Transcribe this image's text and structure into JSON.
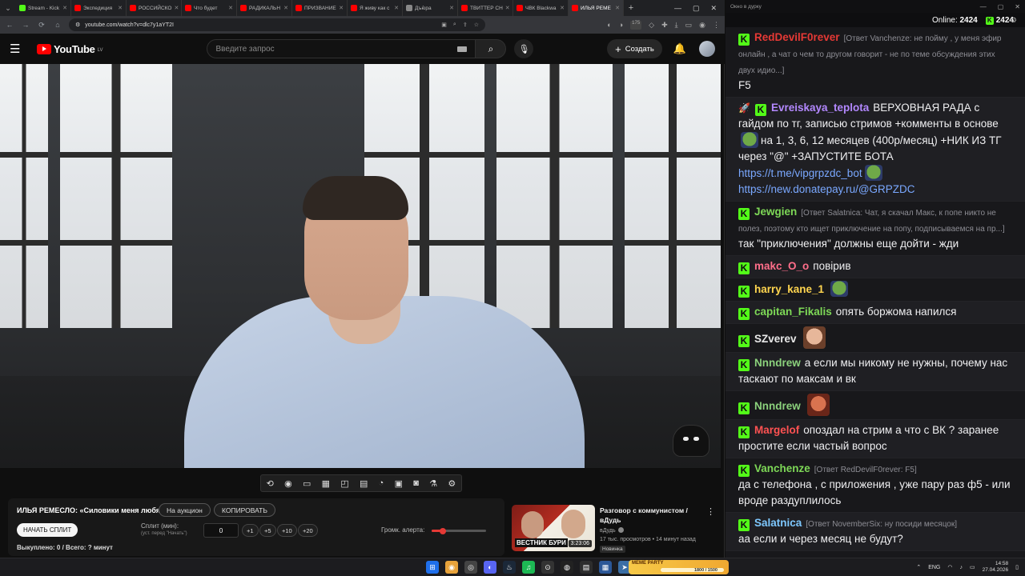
{
  "browser": {
    "tabs": [
      {
        "title": "Stream - Kick",
        "color": "#53fc18",
        "active": false
      },
      {
        "title": "Экспедиция",
        "color": "#ff0000",
        "active": false
      },
      {
        "title": "РОССИЙСКО",
        "color": "#ff0000",
        "active": false
      },
      {
        "title": "Что будет",
        "color": "#ff0000",
        "active": false
      },
      {
        "title": "РАДИКАЛЬН",
        "color": "#ff0000",
        "active": false
      },
      {
        "title": "ПРИЗВАНИЕ",
        "color": "#ff0000",
        "active": false
      },
      {
        "title": "Я живу как с",
        "color": "#ff0000",
        "active": false
      },
      {
        "title": "Дъю̀ра",
        "color": "#888888",
        "active": false
      },
      {
        "title": "ТВИТТЕР СН",
        "color": "#ff0000",
        "active": false
      },
      {
        "title": "ЧВК Blackwa",
        "color": "#ff0000",
        "active": false
      },
      {
        "title": "ИЛЬЯ РЕМЕ",
        "color": "#ff0000",
        "active": true
      }
    ],
    "url": "youtube.com/watch?v=dlc7y1aYT2I",
    "extension_badge": "175"
  },
  "youtube": {
    "logo_text": "YouTube",
    "region": "LV",
    "search_placeholder": "Введите запрос",
    "create_label": "Создать"
  },
  "auction": {
    "title": "ИЛЬЯ РЕМЕСЛО: «Силовики меня любят»",
    "to_auction_label": "На аукцион",
    "copy_label": "КОПИРОВАТЬ",
    "start_split_label": "НАЧАТЬ СПЛИТ",
    "split_label": "Сплит (мин):",
    "split_hint": "(уст. перед \"Начать\")",
    "split_value": "0",
    "increments": [
      "+1",
      "+5",
      "+10",
      "+20"
    ],
    "volume_label": "Громк. алерта:",
    "volume_level": 0.2,
    "stats": "Выкуплено: 0 / Всего: ? минут"
  },
  "recommendation": {
    "title": "Разговор с коммунистом / вДудь",
    "channel": "вДудь",
    "meta": "17 тыс. просмотров • 14 минут назад",
    "badge": "Новинка",
    "duration": "3:23:06",
    "thumb_caption": "ВЕСТНИК БУРИ"
  },
  "chat": {
    "window_title": "Окно в дурку",
    "online_label": "Online:",
    "online_count": "2424",
    "viewers": "2424",
    "messages": [
      {
        "user": "RedDevilF0rever",
        "color": "#e53935",
        "reply": "[Ответ Vanchenze: не пойму , у меня эфир онлайн , а чат о чем то другом говорит - не по теме обсуждения этих двух идио...]",
        "text": "F5"
      },
      {
        "user": "Evreiskaya_teplota",
        "color": "#b388ff",
        "text_parts": [
          "ВЕРХОВНАЯ РАДА с гайдом по тг, записью стримов +комменты в основе",
          "на 1, 3, 6, 12 месяцев (400р/месяц) +НИК ИЗ ТГ через \"@\" +ЗАПУСТИТЕ БОТА"
        ],
        "link1": "https://t.me/vipgrpzdc_bot",
        "link2": "https://new.donatepay.ru/@GRPZDC"
      },
      {
        "user": "Jewgien",
        "color": "#7ed957",
        "reply": "[Ответ Salatnica: Чат, я скачал Макс, к попе никто не полез, поэтому кто ищет приключение на попу, подписываемся на пр...]",
        "text": "так \"приключения\" должны еще дойти - жди"
      },
      {
        "user": "makc_O_o",
        "color": "#ff6e8a",
        "text": "повірив"
      },
      {
        "user": "harry_kane_1",
        "color": "#ffd54f",
        "text": ""
      },
      {
        "user": "capitan_Fikalis",
        "color": "#7ed957",
        "text": "опять боржома напился"
      },
      {
        "user": "SZverev",
        "color": "#e8e8e8",
        "text": ""
      },
      {
        "user": "Nnndrew",
        "color": "#8bd17c",
        "text": "а если мы никому не нужны, почему нас таскают по максам и вк"
      },
      {
        "user": "Nnndrew",
        "color": "#8bd17c",
        "text": ""
      },
      {
        "user": "Margelof",
        "color": "#ff5252",
        "text": "опоздал на стрим а что с ВК ? заранее простите если частый вопрос"
      },
      {
        "user": "Vanchenze",
        "color": "#7ed957",
        "reply": "[Ответ RedDevilF0rever: F5]",
        "text": "да с телефона , с приложения , уже пару раз ф5 - или вроде раздуплилось"
      },
      {
        "user": "Salatnica",
        "color": "#7ec8ff",
        "reply": "[Ответ NovemberSix: ну посиди месяцок]",
        "text": "аа если и через месяц не будут?"
      }
    ]
  },
  "taskbar": {
    "meme_label": "MEME PARTY",
    "meme_progress": "1800 / 1500",
    "lang": "ENG",
    "time": "14:58",
    "date": "27.04.2026"
  }
}
